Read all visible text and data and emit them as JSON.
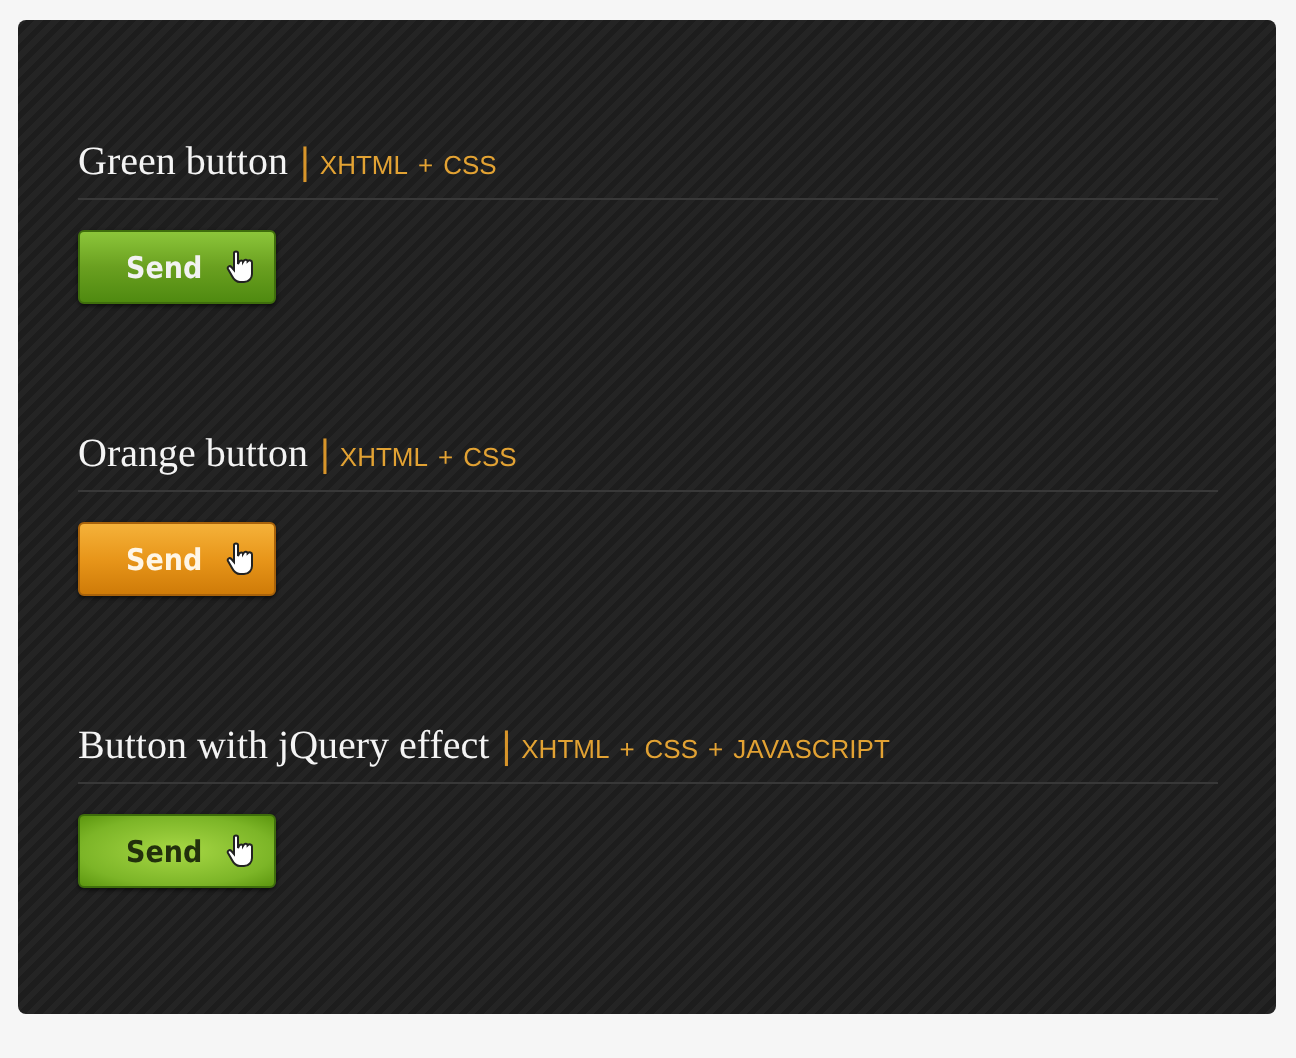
{
  "sections": [
    {
      "title": "Green button",
      "meta": [
        "|",
        "XHTML",
        "+",
        "CSS"
      ],
      "button": {
        "label": "Send",
        "kind": "green"
      }
    },
    {
      "title": "Orange button",
      "meta": [
        "|",
        "XHTML",
        "+",
        "CSS"
      ],
      "button": {
        "label": "Send",
        "kind": "orange"
      }
    },
    {
      "title": "Button with jQuery effect",
      "meta": [
        "|",
        "XHTML",
        "+",
        "CSS",
        "+",
        "JAVASCRIPT"
      ],
      "button": {
        "label": "Send",
        "kind": "green-hover"
      }
    }
  ]
}
